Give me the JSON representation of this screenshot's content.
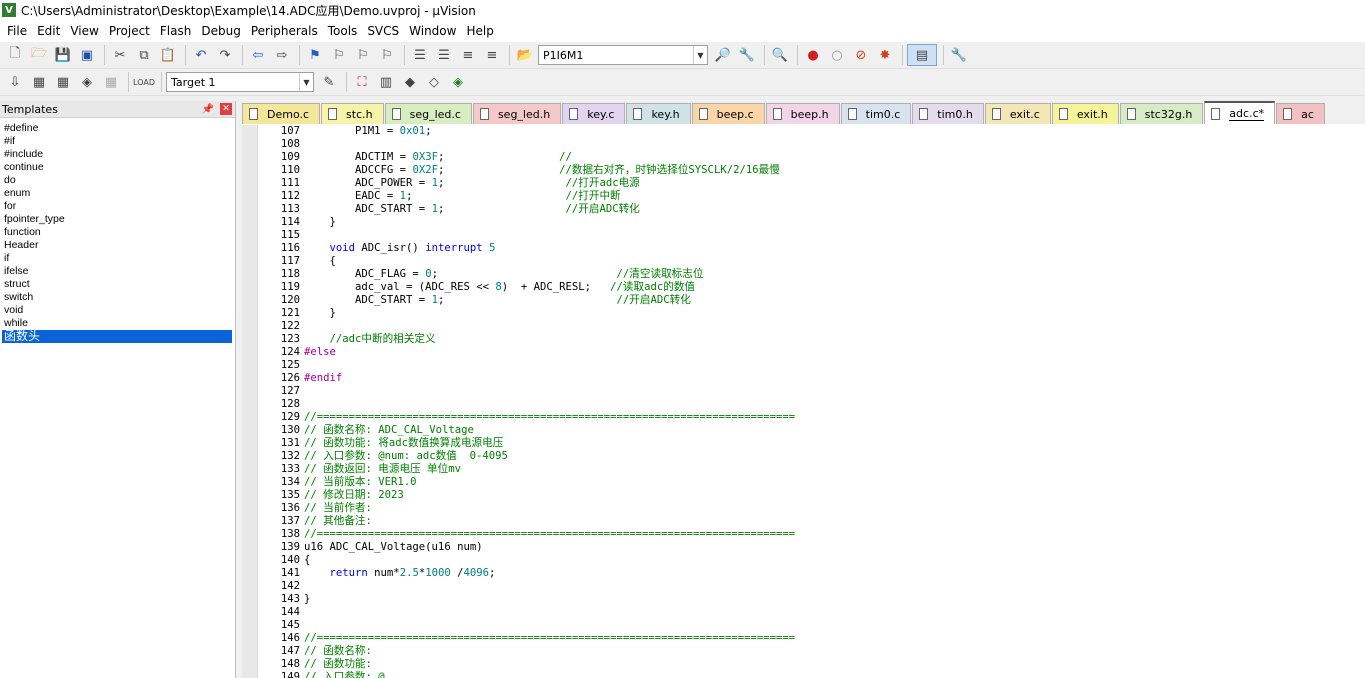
{
  "window": {
    "title": "C:\\Users\\Administrator\\Desktop\\Example\\14.ADC应用\\Demo.uvproj - µVision"
  },
  "menu": [
    "File",
    "Edit",
    "View",
    "Project",
    "Flash",
    "Debug",
    "Peripherals",
    "Tools",
    "SVCS",
    "Window",
    "Help"
  ],
  "toolbar1": {
    "find_value": "P1I6M1"
  },
  "toolbar2": {
    "target": "Target 1"
  },
  "templates": {
    "title": "Templates",
    "items": [
      "#define",
      "#if",
      "#include",
      "continue",
      "do",
      "enum",
      "for",
      "fpointer_type",
      "function",
      "Header",
      "if",
      "ifelse",
      "struct",
      "switch",
      "void",
      "while",
      "函数头"
    ],
    "selected_index": 16
  },
  "tabs": [
    {
      "label": "Demo.c",
      "color": "#f5e79a"
    },
    {
      "label": "stc.h",
      "color": "#f7f3a8"
    },
    {
      "label": "seg_led.c",
      "color": "#d8edc0"
    },
    {
      "label": "seg_led.h",
      "color": "#f6c9c9"
    },
    {
      "label": "key.c",
      "color": "#e2d4f0"
    },
    {
      "label": "key.h",
      "color": "#cfe3e6"
    },
    {
      "label": "beep.c",
      "color": "#f9d6a8"
    },
    {
      "label": "beep.h",
      "color": "#f2d6e8"
    },
    {
      "label": "tim0.c",
      "color": "#d8e2f0"
    },
    {
      "label": "tim0.h",
      "color": "#e4dcec"
    },
    {
      "label": "exit.c",
      "color": "#f5e6b8"
    },
    {
      "label": "exit.h",
      "color": "#f6f39a"
    },
    {
      "label": "stc32g.h",
      "color": "#d6ecc6"
    },
    {
      "label": "adc.c*",
      "color": "#ffffff",
      "active": true
    },
    {
      "label": "ac",
      "color": "#f2c2c2"
    }
  ],
  "code_lines": [
    {
      "n": "107",
      "segs": [
        [
          "",
          "        P1M1 = "
        ],
        [
          "num",
          "0x01"
        ],
        [
          "",
          ";"
        ]
      ]
    },
    {
      "n": "108",
      "segs": []
    },
    {
      "n": "109",
      "segs": [
        [
          "",
          "        ADCTIM = "
        ],
        [
          "num",
          "0X3F"
        ],
        [
          "",
          ";                  "
        ],
        [
          "cm",
          "//"
        ]
      ]
    },
    {
      "n": "110",
      "segs": [
        [
          "",
          "        ADCCFG = "
        ],
        [
          "num",
          "0X2F"
        ],
        [
          "",
          ";                  "
        ],
        [
          "cm",
          "//数据右对齐，时钟选择位SYSCLK/2/16最慢"
        ]
      ]
    },
    {
      "n": "111",
      "segs": [
        [
          "",
          "        ADC_POWER = "
        ],
        [
          "num",
          "1"
        ],
        [
          "",
          ";                   "
        ],
        [
          "cm",
          "//打开adc电源"
        ]
      ]
    },
    {
      "n": "112",
      "segs": [
        [
          "",
          "        EADC = "
        ],
        [
          "num",
          "1"
        ],
        [
          "",
          ";                        "
        ],
        [
          "cm",
          "//打开中断"
        ]
      ]
    },
    {
      "n": "113",
      "segs": [
        [
          "",
          "        ADC_START = "
        ],
        [
          "num",
          "1"
        ],
        [
          "",
          ";                   "
        ],
        [
          "cm",
          "//开启ADC转化"
        ]
      ]
    },
    {
      "n": "114",
      "segs": [
        [
          "",
          "    }"
        ]
      ]
    },
    {
      "n": "115",
      "segs": []
    },
    {
      "n": "116",
      "segs": [
        [
          "",
          "    "
        ],
        [
          "kw",
          "void"
        ],
        [
          "",
          " ADC_isr() "
        ],
        [
          "kw",
          "interrupt"
        ],
        [
          "",
          " "
        ],
        [
          "num",
          "5"
        ]
      ]
    },
    {
      "n": "117",
      "segs": [
        [
          "",
          "    {"
        ]
      ]
    },
    {
      "n": "118",
      "segs": [
        [
          "",
          "        ADC_FLAG = "
        ],
        [
          "num",
          "0"
        ],
        [
          "",
          ";                            "
        ],
        [
          "cm",
          "//清空读取标志位"
        ]
      ]
    },
    {
      "n": "119",
      "segs": [
        [
          "",
          "        adc_val = (ADC_RES << "
        ],
        [
          "num",
          "8"
        ],
        [
          "",
          ")  + ADC_RESL;   "
        ],
        [
          "cm",
          "//读取adc的数值"
        ]
      ]
    },
    {
      "n": "120",
      "segs": [
        [
          "",
          "        ADC_START = "
        ],
        [
          "num",
          "1"
        ],
        [
          "",
          ";                           "
        ],
        [
          "cm",
          "//开启ADC转化"
        ]
      ]
    },
    {
      "n": "121",
      "segs": [
        [
          "",
          "    }"
        ]
      ]
    },
    {
      "n": "122",
      "segs": []
    },
    {
      "n": "123",
      "segs": [
        [
          "",
          "    "
        ],
        [
          "cm",
          "//adc中断的相关定义"
        ]
      ]
    },
    {
      "n": "124",
      "segs": [
        [
          "pp",
          "#else"
        ]
      ]
    },
    {
      "n": "125",
      "segs": []
    },
    {
      "n": "126",
      "segs": [
        [
          "pp",
          "#endif"
        ]
      ]
    },
    {
      "n": "127",
      "segs": []
    },
    {
      "n": "128",
      "segs": []
    },
    {
      "n": "129",
      "segs": [
        [
          "cm",
          "//==========================================================================="
        ]
      ]
    },
    {
      "n": "130",
      "segs": [
        [
          "cm",
          "// 函数名称: ADC_CAL_Voltage"
        ]
      ]
    },
    {
      "n": "131",
      "segs": [
        [
          "cm",
          "// 函数功能: 将adc数值换算成电源电压"
        ]
      ]
    },
    {
      "n": "132",
      "segs": [
        [
          "cm",
          "// 入口参数: @num: adc数值  0-4095"
        ]
      ]
    },
    {
      "n": "133",
      "segs": [
        [
          "cm",
          "// 函数返回: 电源电压 单位mv"
        ]
      ]
    },
    {
      "n": "134",
      "segs": [
        [
          "cm",
          "// 当前版本: VER1.0"
        ]
      ]
    },
    {
      "n": "135",
      "segs": [
        [
          "cm",
          "// 修改日期: 2023"
        ]
      ]
    },
    {
      "n": "136",
      "segs": [
        [
          "cm",
          "// 当前作者:"
        ]
      ]
    },
    {
      "n": "137",
      "segs": [
        [
          "cm",
          "// 其他备注:"
        ]
      ]
    },
    {
      "n": "138",
      "segs": [
        [
          "cm",
          "//==========================================================================="
        ]
      ]
    },
    {
      "n": "139",
      "segs": [
        [
          "",
          "u16 ADC_CAL_Voltage(u16 num)"
        ]
      ]
    },
    {
      "n": "140",
      "segs": [
        [
          "",
          "{"
        ]
      ]
    },
    {
      "n": "141",
      "segs": [
        [
          "",
          "    "
        ],
        [
          "kw",
          "return"
        ],
        [
          "",
          " num*"
        ],
        [
          "num",
          "2.5"
        ],
        [
          "",
          "*"
        ],
        [
          "num",
          "1000"
        ],
        [
          "",
          " /"
        ],
        [
          "num",
          "4096"
        ],
        [
          "",
          ";"
        ]
      ]
    },
    {
      "n": "142",
      "segs": []
    },
    {
      "n": "143",
      "segs": [
        [
          "",
          "}"
        ]
      ]
    },
    {
      "n": "144",
      "segs": []
    },
    {
      "n": "145",
      "segs": []
    },
    {
      "n": "146",
      "segs": [
        [
          "cm",
          "//==========================================================================="
        ]
      ]
    },
    {
      "n": "147",
      "segs": [
        [
          "cm",
          "// 函数名称:"
        ]
      ]
    },
    {
      "n": "148",
      "segs": [
        [
          "cm",
          "// 函数功能:"
        ]
      ]
    },
    {
      "n": "149",
      "segs": [
        [
          "cm",
          "// 入口参数: @"
        ]
      ]
    }
  ]
}
